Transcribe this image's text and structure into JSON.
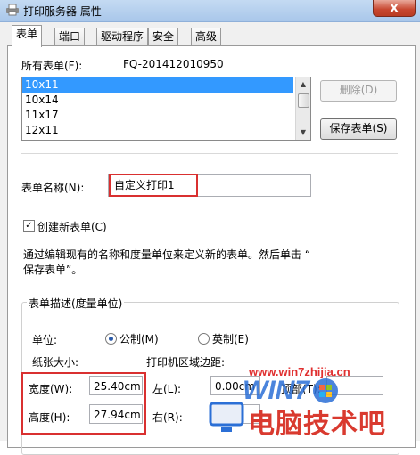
{
  "window": {
    "title": "打印服务器 属性",
    "close_label": "x"
  },
  "tabs": [
    {
      "label": "表单",
      "active": true
    },
    {
      "label": "端口"
    },
    {
      "label": "驱动程序"
    },
    {
      "label": "安全"
    },
    {
      "label": "高级"
    }
  ],
  "forms": {
    "all_forms_label": "所有表单(F):",
    "server_name": "FQ-201412010950",
    "list": [
      "10x11",
      "10x14",
      "11x17",
      "12x11"
    ],
    "selected": "10x11",
    "delete_button": "删除(D)",
    "save_button": "保存表单(S)"
  },
  "form_name": {
    "label": "表单名称(N):",
    "value": "自定义打印1"
  },
  "create_new": {
    "label": "创建新表单(C)",
    "checked": true
  },
  "description_lines": [
    "通过编辑现有的名称和度量单位来定义新的表单。然后单击 “",
    "保存表单”。"
  ],
  "group": {
    "title": "表单描述(度量单位)",
    "unit_label": "单位:",
    "metric_label": "公制(M)",
    "imperial_label": "英制(E)",
    "unit_selected": "metric",
    "paper_size_label": "纸张大小:",
    "printer_margins_label": "打印机区域边距:",
    "width_label": "宽度(W):",
    "width_value": "25.40cm",
    "height_label": "高度(H):",
    "height_value": "27.94cm",
    "left_label": "左(L):",
    "left_value": "0.00cm",
    "top_label": "顶部(T):",
    "right_label": "右(R):"
  },
  "watermark": {
    "url": "www.win7zhijia.cn",
    "logo": "WIN7",
    "brand": "电脑技术吧"
  },
  "colors": {
    "highlight": "#d93030",
    "selection": "#3399ff",
    "titlebar": "#c4daf2"
  }
}
